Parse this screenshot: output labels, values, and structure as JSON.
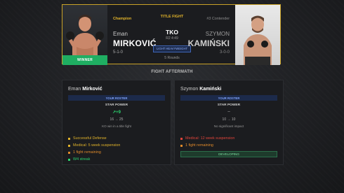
{
  "fight": {
    "title": "TITLE FIGHT",
    "method": "TKO",
    "round_time": "R2 4:49",
    "weight_class": "LIGHT HEAVYWEIGHT",
    "rounds": "5 Rounds"
  },
  "winner": {
    "tag": "Champion",
    "first_name": "Eman",
    "last_name": "MIRKOVIĆ",
    "record": "5-1-0",
    "winner_label": "WINNER"
  },
  "loser": {
    "tag": "#3 Contender",
    "first_name": "SZYMON",
    "last_name": "KAMIŃSKI",
    "record": "3-0-0"
  },
  "aftermath": {
    "title": "FIGHT AFTERMATH"
  },
  "left_panel": {
    "first_name": "Eman",
    "last_name": "Mirković",
    "roster_label": "YOUR ROSTER",
    "star_power_label": "STAR POWER",
    "star_change": "↗+9",
    "star_range": "16 → 25",
    "star_note": "KO win in a title fight",
    "bullets": [
      {
        "text": "Successful Defense",
        "color": "#e0b22a"
      },
      {
        "text": "Medical: 5 week suspension",
        "color": "#e0b22a"
      },
      {
        "text": "1 fight remaining",
        "color": "#e08a2a"
      },
      {
        "text": "W4 streak",
        "color": "#2bd46e"
      }
    ]
  },
  "right_panel": {
    "first_name": "Szymon",
    "last_name": "Kamiński",
    "roster_label": "YOUR ROSTER",
    "star_power_label": "STAR POWER",
    "star_change": "–",
    "star_range": "10 → 10",
    "star_note": "No significant impact",
    "bullets": [
      {
        "text": "Medical: 12 week suspension",
        "color": "#e0443a"
      },
      {
        "text": "1 fight remaining",
        "color": "#e08a2a"
      }
    ],
    "status_label": "DEVELOPING"
  },
  "colors": {
    "gold": "#c9a227",
    "winner_green": "#1fae62",
    "roster_blue": "#7fa3ff"
  }
}
